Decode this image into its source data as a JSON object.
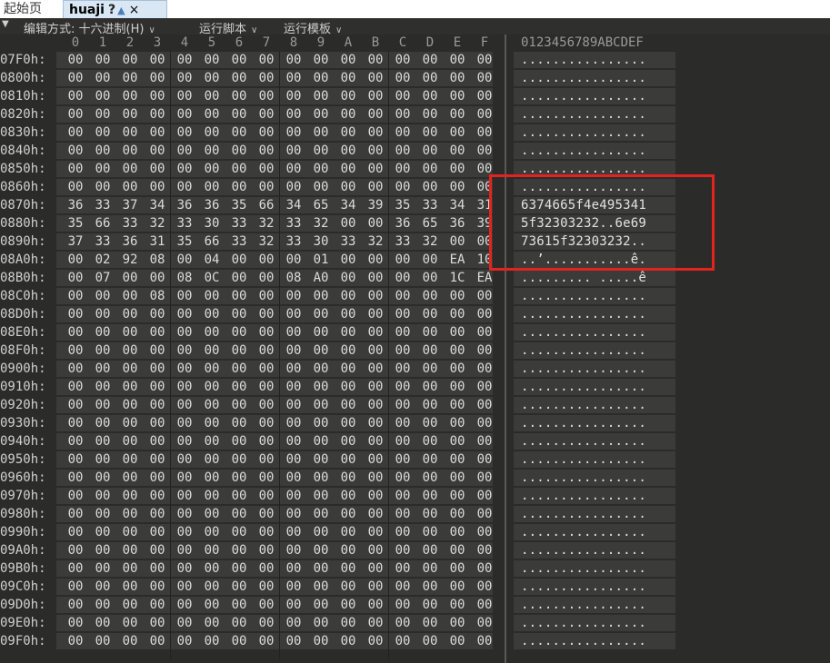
{
  "tabs": {
    "start_label": "起始页",
    "file_label": "huaji",
    "file_modified": "?",
    "close_glyph": "×"
  },
  "toolbar": {
    "edit_mode": "编辑方式: 十六进制(H)",
    "run_script": "运行脚本",
    "run_template": "运行模板"
  },
  "header": {
    "columns": [
      "0",
      "1",
      "2",
      "3",
      "4",
      "5",
      "6",
      "7",
      "8",
      "9",
      "A",
      "B",
      "C",
      "D",
      "E",
      "F"
    ],
    "ascii_header": "0123456789ABCDEF"
  },
  "rows": [
    {
      "addr": "07F0h:",
      "bytes": [
        "00",
        "00",
        "00",
        "00",
        "00",
        "00",
        "00",
        "00",
        "00",
        "00",
        "00",
        "00",
        "00",
        "00",
        "00",
        "00"
      ],
      "ascii": "................"
    },
    {
      "addr": "0800h:",
      "bytes": [
        "00",
        "00",
        "00",
        "00",
        "00",
        "00",
        "00",
        "00",
        "00",
        "00",
        "00",
        "00",
        "00",
        "00",
        "00",
        "00"
      ],
      "ascii": "................"
    },
    {
      "addr": "0810h:",
      "bytes": [
        "00",
        "00",
        "00",
        "00",
        "00",
        "00",
        "00",
        "00",
        "00",
        "00",
        "00",
        "00",
        "00",
        "00",
        "00",
        "00"
      ],
      "ascii": "................"
    },
    {
      "addr": "0820h:",
      "bytes": [
        "00",
        "00",
        "00",
        "00",
        "00",
        "00",
        "00",
        "00",
        "00",
        "00",
        "00",
        "00",
        "00",
        "00",
        "00",
        "00"
      ],
      "ascii": "................"
    },
    {
      "addr": "0830h:",
      "bytes": [
        "00",
        "00",
        "00",
        "00",
        "00",
        "00",
        "00",
        "00",
        "00",
        "00",
        "00",
        "00",
        "00",
        "00",
        "00",
        "00"
      ],
      "ascii": "................"
    },
    {
      "addr": "0840h:",
      "bytes": [
        "00",
        "00",
        "00",
        "00",
        "00",
        "00",
        "00",
        "00",
        "00",
        "00",
        "00",
        "00",
        "00",
        "00",
        "00",
        "00"
      ],
      "ascii": "................"
    },
    {
      "addr": "0850h:",
      "bytes": [
        "00",
        "00",
        "00",
        "00",
        "00",
        "00",
        "00",
        "00",
        "00",
        "00",
        "00",
        "00",
        "00",
        "00",
        "00",
        "00"
      ],
      "ascii": "................"
    },
    {
      "addr": "0860h:",
      "bytes": [
        "00",
        "00",
        "00",
        "00",
        "00",
        "00",
        "00",
        "00",
        "00",
        "00",
        "00",
        "00",
        "00",
        "00",
        "00",
        "00"
      ],
      "ascii": "................"
    },
    {
      "addr": "0870h:",
      "bytes": [
        "36",
        "33",
        "37",
        "34",
        "36",
        "36",
        "35",
        "66",
        "34",
        "65",
        "34",
        "39",
        "35",
        "33",
        "34",
        "31"
      ],
      "ascii": "6374665f4e495341"
    },
    {
      "addr": "0880h:",
      "bytes": [
        "35",
        "66",
        "33",
        "32",
        "33",
        "30",
        "33",
        "32",
        "33",
        "32",
        "00",
        "00",
        "36",
        "65",
        "36",
        "39"
      ],
      "ascii": "5f32303232..6e69"
    },
    {
      "addr": "0890h:",
      "bytes": [
        "37",
        "33",
        "36",
        "31",
        "35",
        "66",
        "33",
        "32",
        "33",
        "30",
        "33",
        "32",
        "33",
        "32",
        "00",
        "00"
      ],
      "ascii": "73615f32303232.."
    },
    {
      "addr": "08A0h:",
      "bytes": [
        "00",
        "02",
        "92",
        "08",
        "00",
        "04",
        "00",
        "00",
        "00",
        "01",
        "00",
        "00",
        "00",
        "00",
        "EA",
        "10"
      ],
      "ascii": "..’...........ê."
    },
    {
      "addr": "08B0h:",
      "bytes": [
        "00",
        "07",
        "00",
        "00",
        "08",
        "0C",
        "00",
        "00",
        "08",
        "A0",
        "00",
        "00",
        "00",
        "00",
        "1C",
        "EA"
      ],
      "ascii": "......... .....ê"
    },
    {
      "addr": "08C0h:",
      "bytes": [
        "00",
        "00",
        "00",
        "08",
        "00",
        "00",
        "00",
        "00",
        "00",
        "00",
        "00",
        "00",
        "00",
        "00",
        "00",
        "00"
      ],
      "ascii": "................"
    },
    {
      "addr": "08D0h:",
      "bytes": [
        "00",
        "00",
        "00",
        "00",
        "00",
        "00",
        "00",
        "00",
        "00",
        "00",
        "00",
        "00",
        "00",
        "00",
        "00",
        "00"
      ],
      "ascii": "................"
    },
    {
      "addr": "08E0h:",
      "bytes": [
        "00",
        "00",
        "00",
        "00",
        "00",
        "00",
        "00",
        "00",
        "00",
        "00",
        "00",
        "00",
        "00",
        "00",
        "00",
        "00"
      ],
      "ascii": "................"
    },
    {
      "addr": "08F0h:",
      "bytes": [
        "00",
        "00",
        "00",
        "00",
        "00",
        "00",
        "00",
        "00",
        "00",
        "00",
        "00",
        "00",
        "00",
        "00",
        "00",
        "00"
      ],
      "ascii": "................"
    },
    {
      "addr": "0900h:",
      "bytes": [
        "00",
        "00",
        "00",
        "00",
        "00",
        "00",
        "00",
        "00",
        "00",
        "00",
        "00",
        "00",
        "00",
        "00",
        "00",
        "00"
      ],
      "ascii": "................"
    },
    {
      "addr": "0910h:",
      "bytes": [
        "00",
        "00",
        "00",
        "00",
        "00",
        "00",
        "00",
        "00",
        "00",
        "00",
        "00",
        "00",
        "00",
        "00",
        "00",
        "00"
      ],
      "ascii": "................"
    },
    {
      "addr": "0920h:",
      "bytes": [
        "00",
        "00",
        "00",
        "00",
        "00",
        "00",
        "00",
        "00",
        "00",
        "00",
        "00",
        "00",
        "00",
        "00",
        "00",
        "00"
      ],
      "ascii": "................"
    },
    {
      "addr": "0930h:",
      "bytes": [
        "00",
        "00",
        "00",
        "00",
        "00",
        "00",
        "00",
        "00",
        "00",
        "00",
        "00",
        "00",
        "00",
        "00",
        "00",
        "00"
      ],
      "ascii": "................"
    },
    {
      "addr": "0940h:",
      "bytes": [
        "00",
        "00",
        "00",
        "00",
        "00",
        "00",
        "00",
        "00",
        "00",
        "00",
        "00",
        "00",
        "00",
        "00",
        "00",
        "00"
      ],
      "ascii": "................"
    },
    {
      "addr": "0950h:",
      "bytes": [
        "00",
        "00",
        "00",
        "00",
        "00",
        "00",
        "00",
        "00",
        "00",
        "00",
        "00",
        "00",
        "00",
        "00",
        "00",
        "00"
      ],
      "ascii": "................"
    },
    {
      "addr": "0960h:",
      "bytes": [
        "00",
        "00",
        "00",
        "00",
        "00",
        "00",
        "00",
        "00",
        "00",
        "00",
        "00",
        "00",
        "00",
        "00",
        "00",
        "00"
      ],
      "ascii": "................"
    },
    {
      "addr": "0970h:",
      "bytes": [
        "00",
        "00",
        "00",
        "00",
        "00",
        "00",
        "00",
        "00",
        "00",
        "00",
        "00",
        "00",
        "00",
        "00",
        "00",
        "00"
      ],
      "ascii": "................"
    },
    {
      "addr": "0980h:",
      "bytes": [
        "00",
        "00",
        "00",
        "00",
        "00",
        "00",
        "00",
        "00",
        "00",
        "00",
        "00",
        "00",
        "00",
        "00",
        "00",
        "00"
      ],
      "ascii": "................"
    },
    {
      "addr": "0990h:",
      "bytes": [
        "00",
        "00",
        "00",
        "00",
        "00",
        "00",
        "00",
        "00",
        "00",
        "00",
        "00",
        "00",
        "00",
        "00",
        "00",
        "00"
      ],
      "ascii": "................"
    },
    {
      "addr": "09A0h:",
      "bytes": [
        "00",
        "00",
        "00",
        "00",
        "00",
        "00",
        "00",
        "00",
        "00",
        "00",
        "00",
        "00",
        "00",
        "00",
        "00",
        "00"
      ],
      "ascii": "................"
    },
    {
      "addr": "09B0h:",
      "bytes": [
        "00",
        "00",
        "00",
        "00",
        "00",
        "00",
        "00",
        "00",
        "00",
        "00",
        "00",
        "00",
        "00",
        "00",
        "00",
        "00"
      ],
      "ascii": "................"
    },
    {
      "addr": "09C0h:",
      "bytes": [
        "00",
        "00",
        "00",
        "00",
        "00",
        "00",
        "00",
        "00",
        "00",
        "00",
        "00",
        "00",
        "00",
        "00",
        "00",
        "00"
      ],
      "ascii": "................"
    },
    {
      "addr": "09D0h:",
      "bytes": [
        "00",
        "00",
        "00",
        "00",
        "00",
        "00",
        "00",
        "00",
        "00",
        "00",
        "00",
        "00",
        "00",
        "00",
        "00",
        "00"
      ],
      "ascii": "................"
    },
    {
      "addr": "09E0h:",
      "bytes": [
        "00",
        "00",
        "00",
        "00",
        "00",
        "00",
        "00",
        "00",
        "00",
        "00",
        "00",
        "00",
        "00",
        "00",
        "00",
        "00"
      ],
      "ascii": "................"
    },
    {
      "addr": "09F0h:",
      "bytes": [
        "00",
        "00",
        "00",
        "00",
        "00",
        "00",
        "00",
        "00",
        "00",
        "00",
        "00",
        "00",
        "00",
        "00",
        "00",
        "00"
      ],
      "ascii": "................"
    }
  ],
  "colors": {
    "background": "#2b2b2a",
    "row_stripe": "#3b3b3a",
    "highlight_box": "#e3231e",
    "tab_active": "#d9e6f3"
  }
}
